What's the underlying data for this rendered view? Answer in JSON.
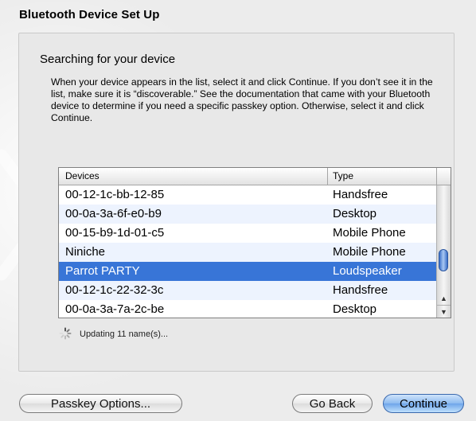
{
  "window": {
    "title": "Bluetooth Device Set Up"
  },
  "main": {
    "heading": "Searching for your device",
    "instructions": "When your device appears in the list, select it and click Continue. If you don’t see it in the list, make sure it is “discoverable.” See the documentation that came with your Bluetooth device to determine if you need a specific passkey option. Otherwise, select it and click Continue."
  },
  "table": {
    "columns": {
      "devices": "Devices",
      "type": "Type"
    },
    "rows": [
      {
        "name": "00-12-1c-bb-12-85",
        "type": "Handsfree"
      },
      {
        "name": "00-0a-3a-6f-e0-b9",
        "type": "Desktop"
      },
      {
        "name": "00-15-b9-1d-01-c5",
        "type": "Mobile Phone"
      },
      {
        "name": "Niniche",
        "type": "Mobile Phone"
      },
      {
        "name": "Parrot PARTY",
        "type": "Loudspeaker"
      },
      {
        "name": "00-12-1c-22-32-3c",
        "type": "Handsfree"
      },
      {
        "name": "00-0a-3a-7a-2c-be",
        "type": "Desktop"
      }
    ],
    "selected_row": 4,
    "scrollbar": {
      "up_arrow": "▲",
      "down_arrow": "▼"
    }
  },
  "status": {
    "text": "Updating 11 name(s)..."
  },
  "buttons": {
    "passkey": "Passkey Options...",
    "back": "Go Back",
    "continue": "Continue"
  },
  "colors": {
    "selection": "#3875d7",
    "alt_row": "#edf3fe",
    "default_button": "#8cbaf0"
  },
  "icons": {
    "watermark": "bluetooth-logo-icon",
    "spinner": "progress-spinner-icon"
  }
}
